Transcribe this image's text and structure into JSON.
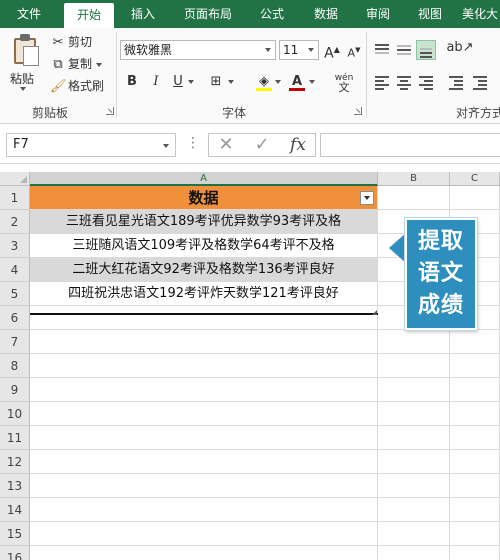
{
  "ribbon": {
    "tabs": [
      {
        "label": "文件"
      },
      {
        "label": "开始"
      },
      {
        "label": "插入"
      },
      {
        "label": "页面布局"
      },
      {
        "label": "公式"
      },
      {
        "label": "数据"
      },
      {
        "label": "审阅"
      },
      {
        "label": "视图"
      },
      {
        "label": "美化大"
      }
    ],
    "active_tab": "开始",
    "clipboard": {
      "paste_label": "粘贴",
      "cut_label": "剪切",
      "copy_label": "复制",
      "format_painter_label": "格式刷",
      "group_label": "剪贴板"
    },
    "font": {
      "font_name": "微软雅黑",
      "font_size": "11",
      "grow_label": "A",
      "shrink_label": "A",
      "bold_label": "B",
      "italic_label": "I",
      "underline_label": "U",
      "phonetic_label": "wén",
      "phonetic_sub": "文",
      "font_color_label": "A",
      "group_label": "字体"
    },
    "alignment": {
      "group_label": "对齐方式"
    },
    "colors": {
      "tab_bar": "#217346",
      "font_color": "#c00000",
      "fill_color": "#ffff00"
    }
  },
  "formula_bar": {
    "name_box": "F7",
    "separator": "⋮",
    "cancel_icon": "✕",
    "enter_icon": "✓",
    "fx_label": "fx",
    "formula": ""
  },
  "sheet": {
    "columns": [
      "A",
      "B",
      "C"
    ],
    "rows": [
      "1",
      "2",
      "3",
      "4",
      "5",
      "6",
      "7",
      "8",
      "9",
      "10",
      "11",
      "12",
      "13",
      "14",
      "15",
      "16"
    ],
    "header": "数据",
    "data": [
      "三班看见星光语文189考评优异数学93考评及格",
      "三班随风语文109考评及格数学64考评不及格",
      "二班大红花语文92考评及格数学136考评良好",
      "四班祝洪忠语文192考评炸天数学121考评良好"
    ],
    "colors": {
      "header_fill": "#f0903a",
      "band_fill": "#d9d9d9"
    }
  },
  "callout": {
    "text_lines": [
      "提取",
      "语文",
      "成绩"
    ],
    "color": "#2e8fbf"
  }
}
